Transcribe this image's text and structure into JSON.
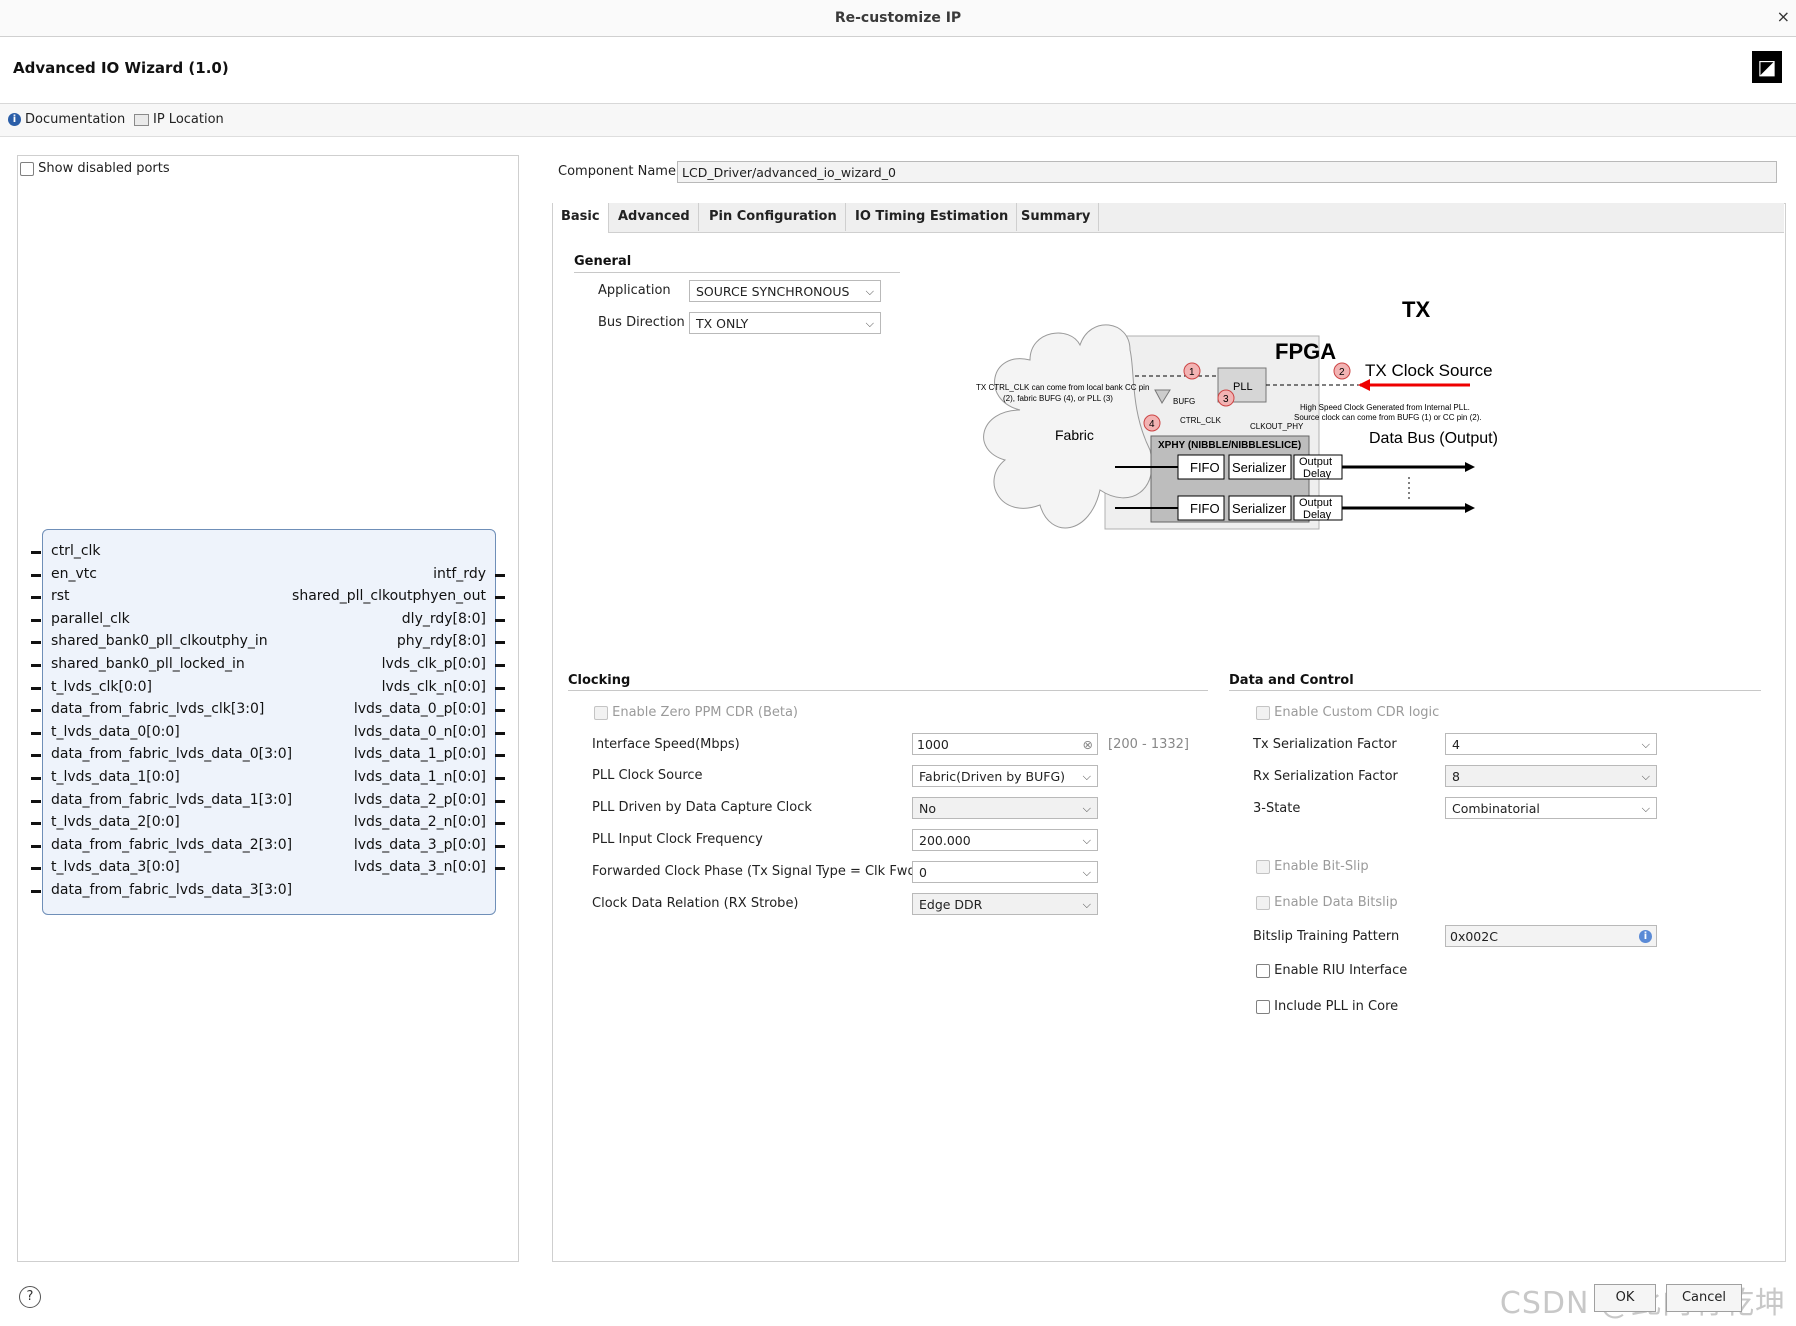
{
  "window": {
    "title": "Re-customize IP",
    "close_glyph": "×"
  },
  "header": {
    "title": "Advanced IO Wizard (1.0)",
    "logo_glyph": "◪"
  },
  "toolbar": {
    "documentation": "Documentation",
    "ip_location": "IP Location"
  },
  "left": {
    "show_disabled_ports": "Show disabled ports",
    "ports_left": [
      "ctrl_clk",
      "en_vtc",
      "rst",
      "parallel_clk",
      "shared_bank0_pll_clkoutphy_in",
      "shared_bank0_pll_locked_in",
      "t_lvds_clk[0:0]",
      "data_from_fabric_lvds_clk[3:0]",
      "t_lvds_data_0[0:0]",
      "data_from_fabric_lvds_data_0[3:0]",
      "t_lvds_data_1[0:0]",
      "data_from_fabric_lvds_data_1[3:0]",
      "t_lvds_data_2[0:0]",
      "data_from_fabric_lvds_data_2[3:0]",
      "t_lvds_data_3[0:0]",
      "data_from_fabric_lvds_data_3[3:0]"
    ],
    "ports_right": [
      "intf_rdy",
      "shared_pll_clkoutphyen_out",
      "dly_rdy[8:0]",
      "phy_rdy[8:0]",
      "lvds_clk_p[0:0]",
      "lvds_clk_n[0:0]",
      "lvds_data_0_p[0:0]",
      "lvds_data_0_n[0:0]",
      "lvds_data_1_p[0:0]",
      "lvds_data_1_n[0:0]",
      "lvds_data_2_p[0:0]",
      "lvds_data_2_n[0:0]",
      "lvds_data_3_p[0:0]",
      "lvds_data_3_n[0:0]"
    ]
  },
  "component": {
    "label": "Component Name",
    "value": "LCD_Driver/advanced_io_wizard_0"
  },
  "tabs": [
    "Basic",
    "Advanced",
    "Pin Configuration",
    "IO Timing Estimation",
    "Summary"
  ],
  "general": {
    "title": "General",
    "application_label": "Application",
    "application_value": "SOURCE SYNCHRONOUS",
    "bus_direction_label": "Bus Direction",
    "bus_direction_value": "TX ONLY"
  },
  "diagram": {
    "tx": "TX",
    "fpga": "FPGA",
    "fabric": "Fabric",
    "pll": "PLL",
    "bufg": "BUFG",
    "ctrl_clk": "CTRL_CLK",
    "clkout_phy": "CLKOUT_PHY",
    "tx_clock_source": "TX Clock Source",
    "data_bus": "Data Bus (Output)",
    "xphy": "XPHY (NIBBLE/NIBBLESLICE)",
    "fifo": "FIFO",
    "serializer": "Serializer",
    "output": "Output",
    "delay": "Delay",
    "note_left_1": "TX CTRL_CLK  can come from local bank CC pin",
    "note_left_2": "(2), fabric BUFG (4), or PLL (3)",
    "note_right_1": "High Speed Clock Generated from Internal PLL.",
    "note_right_2": "Source clock can come from BUFG (1) or CC pin (2).",
    "n1": "1",
    "n2": "2",
    "n3": "3",
    "n4": "4"
  },
  "clocking": {
    "title": "Clocking",
    "zero_ppm": "Enable Zero PPM CDR (Beta)",
    "speed_label": "Interface Speed(Mbps)",
    "speed_value": "1000",
    "speed_range": "[200 - 1332]",
    "pll_src_label": "PLL Clock Source",
    "pll_src_value": "Fabric(Driven by BUFG)",
    "pll_driven_label": "PLL Driven by Data Capture Clock",
    "pll_driven_value": "No",
    "pll_freq_label": "PLL Input Clock Frequency",
    "pll_freq_value": "200.000",
    "fwd_phase_label": "Forwarded Clock Phase (Tx Signal Type = Clk Fwd)",
    "fwd_phase_value": "0",
    "cdr_label": "Clock Data Relation (RX Strobe)",
    "cdr_value": "Edge DDR"
  },
  "datacontrol": {
    "title": "Data and Control",
    "custom_cdr": "Enable Custom CDR logic",
    "tx_ser_label": "Tx Serialization Factor",
    "tx_ser_value": "4",
    "rx_ser_label": "Rx Serialization Factor",
    "rx_ser_value": "8",
    "tristate_label": "3-State",
    "tristate_value": "Combinatorial",
    "bitslip": "Enable Bit-Slip",
    "data_bitslip": "Enable Data Bitslip",
    "bitslip_pattern_label": "Bitslip Training Pattern",
    "bitslip_pattern_value": "0x002C",
    "riu": "Enable RIU Interface",
    "include_pll": "Include PLL in Core"
  },
  "footer": {
    "help": "?",
    "ok": "OK",
    "cancel": "Cancel",
    "watermark": "CSDN @此内有乾坤"
  }
}
